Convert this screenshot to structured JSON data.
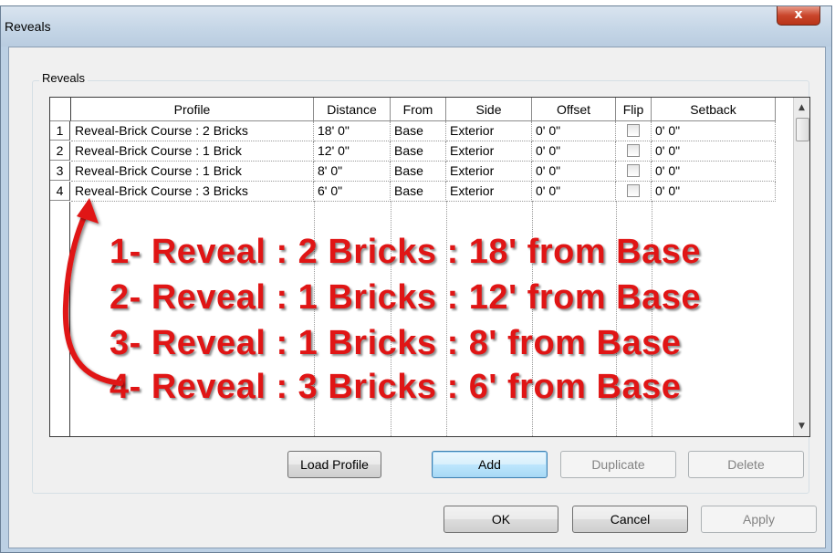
{
  "dialog": {
    "title": "Reveals",
    "close_glyph": "x",
    "group_label": "Reveals"
  },
  "table": {
    "headers": [
      "Profile",
      "Distance",
      "From",
      "Side",
      "Offset",
      "Flip",
      "Setback"
    ],
    "rows": [
      {
        "num": "1",
        "profile": "Reveal-Brick Course : 2 Bricks",
        "distance": "18'  0\"",
        "from": "Base",
        "side": "Exterior",
        "offset": "0'  0\"",
        "flip": false,
        "setback": "0'  0\""
      },
      {
        "num": "2",
        "profile": "Reveal-Brick Course : 1 Brick",
        "distance": "12'  0\"",
        "from": "Base",
        "side": "Exterior",
        "offset": "0'  0\"",
        "flip": false,
        "setback": "0'  0\""
      },
      {
        "num": "3",
        "profile": "Reveal-Brick Course : 1 Brick",
        "distance": "8'  0\"",
        "from": "Base",
        "side": "Exterior",
        "offset": "0'  0\"",
        "flip": false,
        "setback": "0'  0\""
      },
      {
        "num": "4",
        "profile": "Reveal-Brick Course : 3 Bricks",
        "distance": "6'  0\"",
        "from": "Base",
        "side": "Exterior",
        "offset": "0'  0\"",
        "flip": false,
        "setback": "0'  0\""
      }
    ]
  },
  "buttons": {
    "load_profile": "Load Profile",
    "add": "Add",
    "duplicate": "Duplicate",
    "delete": "Delete",
    "ok": "OK",
    "cancel": "Cancel",
    "apply": "Apply"
  },
  "annotations": [
    "1- Reveal : 2 Bricks : 18' from Base",
    "2- Reveal : 1 Bricks : 12' from Base",
    "3- Reveal : 1 Bricks : 8' from Base",
    "4- Reveal : 3 Bricks : 6' from Base"
  ],
  "colors": {
    "annotation": "#e01515",
    "close_button": "#c9452b"
  },
  "icons": {
    "close": "close-icon",
    "scroll_up": "chevron-up-icon",
    "scroll_down": "chevron-down-icon"
  }
}
